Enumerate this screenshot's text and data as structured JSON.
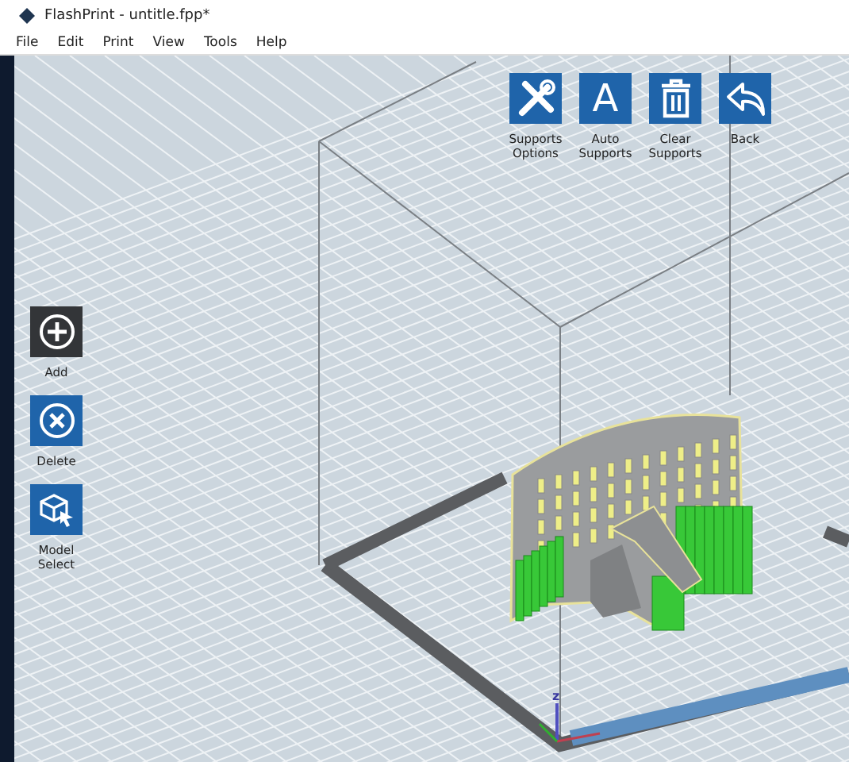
{
  "window": {
    "title": "FlashPrint - untitle.fpp*"
  },
  "menu": [
    "File",
    "Edit",
    "Print",
    "View",
    "Tools",
    "Help"
  ],
  "top_toolbar": [
    {
      "kind": "tools",
      "label": "Supports Options"
    },
    {
      "kind": "letter",
      "label": "Auto Supports",
      "glyph": "A"
    },
    {
      "kind": "trash",
      "label": "Clear Supports"
    },
    {
      "kind": "back",
      "label": "Back"
    }
  ],
  "left_toolbar": [
    {
      "kind": "add",
      "label": "Add",
      "selected": true
    },
    {
      "kind": "delete",
      "label": "Delete",
      "selected": false
    },
    {
      "kind": "select",
      "label": "Model Select",
      "selected": false
    }
  ],
  "axes": {
    "z": "z"
  }
}
